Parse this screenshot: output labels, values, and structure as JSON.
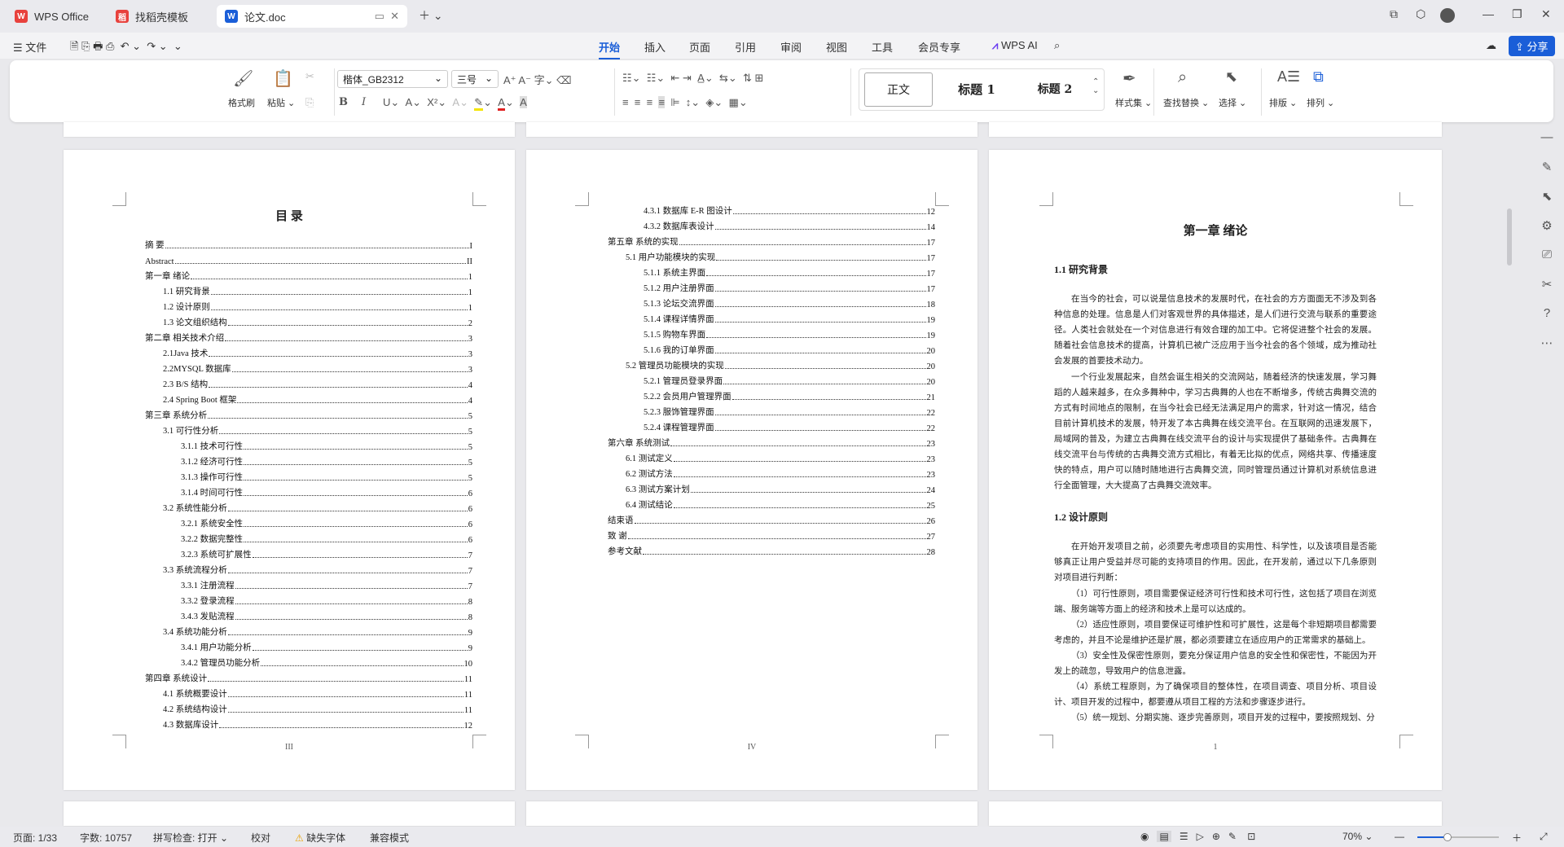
{
  "tabs": [
    {
      "label": "WPS Office",
      "color": "#e8413c",
      "icon": "W"
    },
    {
      "label": "找稻壳模板",
      "color": "#e8413c",
      "icon": "稻"
    },
    {
      "label": "论文.doc",
      "color": "#1a5ed8",
      "icon": "W"
    }
  ],
  "menu": {
    "file": "文件",
    "items": [
      "开始",
      "插入",
      "页面",
      "引用",
      "审阅",
      "视图",
      "工具",
      "会员专享"
    ],
    "ai": "WPS AI",
    "share": "分享"
  },
  "ribbon": {
    "format_painter": "格式刷",
    "paste": "粘贴",
    "font": "楷体_GB2312",
    "size": "三号",
    "styles": [
      "正文",
      "标题 1",
      "标题 2"
    ],
    "style_set": "样式集",
    "find_replace": "查找替换",
    "select": "选择",
    "layout": "排版",
    "arrange": "排列"
  },
  "page1": {
    "title": "目 录",
    "footer": "III",
    "toc": [
      {
        "t": "摘 要",
        "p": "I",
        "lvl": 0
      },
      {
        "t": "Abstract",
        "p": "II",
        "lvl": 0
      },
      {
        "t": "第一章 绪论",
        "p": "1",
        "lvl": 0
      },
      {
        "t": "1.1 研究背景",
        "p": "1",
        "lvl": 1
      },
      {
        "t": "1.2 设计原则",
        "p": "1",
        "lvl": 1
      },
      {
        "t": "1.3 论文组织结构",
        "p": "2",
        "lvl": 1
      },
      {
        "t": "第二章 相关技术介绍",
        "p": "3",
        "lvl": 0
      },
      {
        "t": "2.1Java 技术",
        "p": "3",
        "lvl": 1
      },
      {
        "t": "2.2MYSQL 数据库",
        "p": "3",
        "lvl": 1
      },
      {
        "t": "2.3 B/S 结构",
        "p": "4",
        "lvl": 1
      },
      {
        "t": "2.4 Spring Boot 框架",
        "p": "4",
        "lvl": 1
      },
      {
        "t": "第三章 系统分析",
        "p": "5",
        "lvl": 0
      },
      {
        "t": "3.1 可行性分析",
        "p": "5",
        "lvl": 1
      },
      {
        "t": "3.1.1 技术可行性",
        "p": "5",
        "lvl": 2
      },
      {
        "t": "3.1.2 经济可行性",
        "p": "5",
        "lvl": 2
      },
      {
        "t": "3.1.3 操作可行性",
        "p": "5",
        "lvl": 2
      },
      {
        "t": "3.1.4 时间可行性",
        "p": "6",
        "lvl": 2
      },
      {
        "t": "3.2 系统性能分析",
        "p": "6",
        "lvl": 1
      },
      {
        "t": "3.2.1 系统安全性",
        "p": "6",
        "lvl": 2
      },
      {
        "t": "3.2.2 数据完整性",
        "p": "6",
        "lvl": 2
      },
      {
        "t": "3.2.3 系统可扩展性",
        "p": "7",
        "lvl": 2
      },
      {
        "t": "3.3 系统流程分析",
        "p": "7",
        "lvl": 1
      },
      {
        "t": "3.3.1 注册流程",
        "p": "7",
        "lvl": 2
      },
      {
        "t": "3.3.2 登录流程",
        "p": "8",
        "lvl": 2
      },
      {
        "t": "3.4.3 发贴流程",
        "p": "8",
        "lvl": 2
      },
      {
        "t": "3.4 系统功能分析",
        "p": "9",
        "lvl": 1
      },
      {
        "t": "3.4.1 用户功能分析",
        "p": "9",
        "lvl": 2
      },
      {
        "t": "3.4.2 管理员功能分析",
        "p": "10",
        "lvl": 2
      },
      {
        "t": "第四章 系统设计",
        "p": "11",
        "lvl": 0
      },
      {
        "t": "4.1 系统概要设计",
        "p": "11",
        "lvl": 1
      },
      {
        "t": "4.2 系统结构设计",
        "p": "11",
        "lvl": 1
      },
      {
        "t": "4.3 数据库设计",
        "p": "12",
        "lvl": 1
      }
    ]
  },
  "page2": {
    "footer": "IV",
    "toc": [
      {
        "t": "4.3.1 数据库 E-R 图设计",
        "p": "12",
        "lvl": 2
      },
      {
        "t": "4.3.2 数据库表设计",
        "p": "14",
        "lvl": 2
      },
      {
        "t": "第五章 系统的实现",
        "p": "17",
        "lvl": 0
      },
      {
        "t": "5.1 用户功能模块的实现",
        "p": "17",
        "lvl": 1
      },
      {
        "t": "5.1.1 系统主界面",
        "p": "17",
        "lvl": 2
      },
      {
        "t": "5.1.2 用户注册界面",
        "p": "17",
        "lvl": 2
      },
      {
        "t": "5.1.3 论坛交流界面",
        "p": "18",
        "lvl": 2
      },
      {
        "t": "5.1.4 课程详情界面",
        "p": "19",
        "lvl": 2
      },
      {
        "t": "5.1.5 购物车界面",
        "p": "19",
        "lvl": 2
      },
      {
        "t": "5.1.6 我的订单界面",
        "p": "20",
        "lvl": 2
      },
      {
        "t": "5.2 管理员功能模块的实现",
        "p": "20",
        "lvl": 1
      },
      {
        "t": "5.2.1 管理员登录界面",
        "p": "20",
        "lvl": 2
      },
      {
        "t": "5.2.2 会员用户管理界面",
        "p": "21",
        "lvl": 2
      },
      {
        "t": "5.2.3 服饰管理界面",
        "p": "22",
        "lvl": 2
      },
      {
        "t": "5.2.4 课程管理界面",
        "p": "22",
        "lvl": 2
      },
      {
        "t": "第六章 系统测试",
        "p": "23",
        "lvl": 0
      },
      {
        "t": "6.1 测试定义",
        "p": "23",
        "lvl": 1
      },
      {
        "t": "6.2 测试方法",
        "p": "23",
        "lvl": 1
      },
      {
        "t": "6.3 测试方案计划",
        "p": "24",
        "lvl": 1
      },
      {
        "t": "6.4 测试结论",
        "p": "25",
        "lvl": 1
      },
      {
        "t": "结束语",
        "p": "26",
        "lvl": 0
      },
      {
        "t": "致 谢",
        "p": "27",
        "lvl": 0
      },
      {
        "t": "参考文献",
        "p": "28",
        "lvl": 0
      }
    ]
  },
  "page3": {
    "chapter": "第一章 绪论",
    "h1": "1.1 研究背景",
    "p1": "在当今的社会，可以说是信息技术的发展时代，在社会的方方面面无不涉及到各种信息的处理。信息是人们对客观世界的具体描述，是人们进行交流与联系的重要途径。人类社会就处在一个对信息进行有效合理的加工中。它将促进整个社会的发展。随着社会信息技术的提高，计算机已被广泛应用于当今社会的各个领域，成为推动社会发展的首要技术动力。",
    "p2": "一个行业发展起来，自然会诞生相关的交流网站，随着经济的快速发展，学习舞蹈的人越来越多，在众多舞种中，学习古典舞的人也在不断增多，传统古典舞交流的方式有时间地点的限制，在当今社会已经无法满足用户的需求，针对这一情况，结合目前计算机技术的发展，特开发了本古典舞在线交流平台。在互联网的迅速发展下，局域网的普及，为建立古典舞在线交流平台的设计与实现提供了基础条件。古典舞在线交流平台与传统的古典舞交流方式相比，有着无比拟的优点，网络共享、传播速度快的特点，用户可以随时随地进行古典舞交流，同时管理员通过计算机对系统信息进行全面管理，大大提高了古典舞交流效率。",
    "h2": "1.2 设计原则",
    "p3": "在开始开发项目之前，必须要先考虑项目的实用性、科学性，以及该项目是否能够真正让用户受益并尽可能的支持项目的作用。因此，在开发前，通过以下几条原则对项目进行判断：",
    "p4": "（1）可行性原则，项目需要保证经济可行性和技术可行性，这包括了项目在浏览端、服务端等方面上的经济和技术上是可以达成的。",
    "p5": "（2）适应性原则，项目要保证可维护性和可扩展性，这是每个非短期项目都需要考虑的，并且不论是维护还是扩展，都必须要建立在适应用户的正常需求的基础上。",
    "p6": "（3）安全性及保密性原则，要充分保证用户信息的安全性和保密性，不能因为开发上的疏忽，导致用户的信息泄露。",
    "p7": "（4）系统工程原则，为了确保项目的整体性，在项目调查、项目分析、项目设计、项目开发的过程中，都要遵从项目工程的方法和步骤逐步进行。",
    "p8": "（5）统一规划、分期实施、逐步完善原则，项目开发的过程中，要按照规划、分",
    "footer": "1"
  },
  "status": {
    "page": "页面: 1/33",
    "words": "字数: 10757",
    "spell": "拼写检查: 打开",
    "proof": "校对",
    "missing_font": "缺失字体",
    "compat": "兼容模式",
    "zoom": "70%"
  }
}
